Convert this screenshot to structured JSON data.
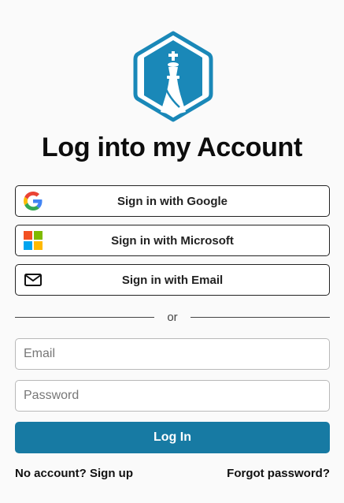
{
  "title": "Log into my Account",
  "sso": {
    "google_label": "Sign in with Google",
    "microsoft_label": "Sign in with Microsoft",
    "email_label": "Sign in with Email"
  },
  "divider_text": "or",
  "form": {
    "email_placeholder": "Email",
    "email_value": "",
    "password_placeholder": "Password",
    "password_value": "",
    "submit_label": "Log In"
  },
  "links": {
    "signup": "No account? Sign up",
    "forgot": "Forgot password?"
  },
  "colors": {
    "brand": "#1a88b8",
    "primary_button": "#177aa3",
    "background": "#fafafa"
  },
  "icons": {
    "logo": "chess-king-hexagon-logo",
    "google": "google-g-icon",
    "microsoft": "microsoft-four-squares-icon",
    "email": "envelope-icon"
  }
}
